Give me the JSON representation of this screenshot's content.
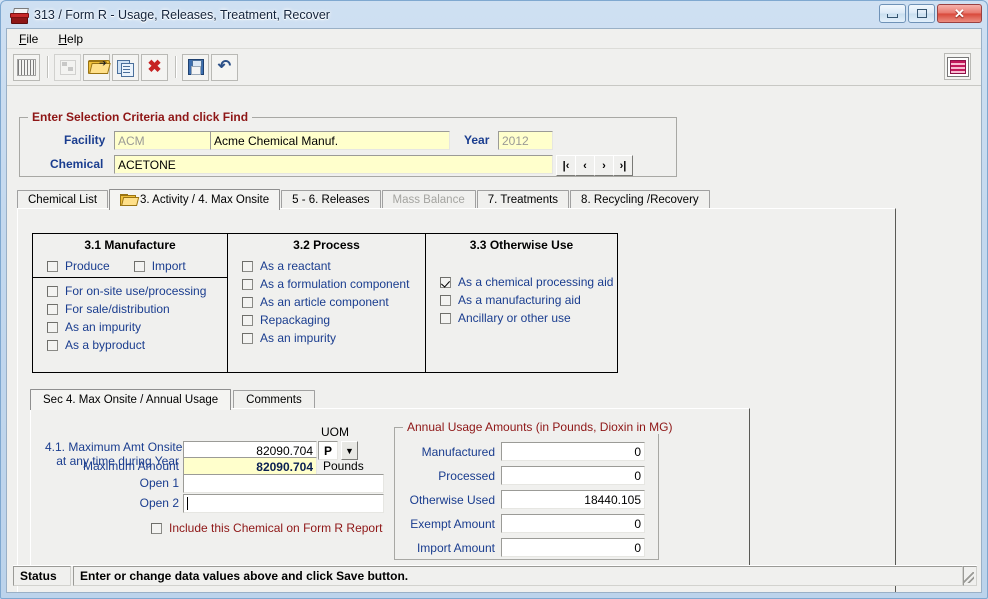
{
  "window": {
    "title": "313 / Form R - Usage, Releases, Treatment, Recover",
    "app_icon": "form-stamp-icon",
    "minimize_label": "",
    "maximize_label": "",
    "close_label": "✕"
  },
  "menu": {
    "items": [
      {
        "label": "File",
        "accel": "F",
        "rest": "ile"
      },
      {
        "label": "Help",
        "accel": "H",
        "rest": "elp"
      }
    ]
  },
  "toolbar": {
    "buttons": [
      {
        "name": "barcode-button",
        "icon": "barcode-icon",
        "enabled": true
      },
      {
        "name": "find-button",
        "icon": "find-records-icon",
        "enabled": false
      },
      {
        "name": "open-button",
        "icon": "open-folder-icon",
        "enabled": true
      },
      {
        "name": "copy-button",
        "icon": "copy-icon",
        "enabled": true
      },
      {
        "name": "delete-button",
        "icon": "delete-x-icon",
        "enabled": true
      },
      {
        "name": "save-button",
        "icon": "save-disk-icon",
        "enabled": true
      },
      {
        "name": "undo-button",
        "icon": "undo-arrow-icon",
        "enabled": true
      }
    ],
    "right_button": {
      "name": "report-grid-button",
      "icon": "grid-table-icon"
    }
  },
  "selection_criteria": {
    "title": "Enter Selection Criteria and click Find",
    "facility_label": "Facility",
    "facility_code": "ACM",
    "facility_name": "Acme Chemical Manuf.",
    "year_label": "Year",
    "year_value": "2012",
    "chemical_label": "Chemical",
    "chemical_value": "ACETONE",
    "nav": {
      "first": "|‹",
      "prev": "‹",
      "next": "›",
      "last": "›|"
    }
  },
  "tabs": [
    {
      "label": "Chemical List",
      "active": false,
      "disabled": false,
      "icon": ""
    },
    {
      "label": "3. Activity / 4. Max Onsite",
      "active": true,
      "disabled": false,
      "icon": "open-folder-icon"
    },
    {
      "label": "5 - 6. Releases",
      "active": false,
      "disabled": false,
      "icon": ""
    },
    {
      "label": "Mass Balance",
      "active": false,
      "disabled": true,
      "icon": ""
    },
    {
      "label": "7. Treatments",
      "active": false,
      "disabled": false,
      "icon": ""
    },
    {
      "label": "8. Recycling /Recovery",
      "active": false,
      "disabled": false,
      "icon": ""
    }
  ],
  "activity": {
    "manufacture": {
      "title": "3.1 Manufacture",
      "top_row": [
        {
          "label": "Produce",
          "checked": false
        },
        {
          "label": "Import",
          "checked": false
        }
      ],
      "items": [
        {
          "label": "For on-site use/processing",
          "checked": false
        },
        {
          "label": "For sale/distribution",
          "checked": false
        },
        {
          "label": "As an impurity",
          "checked": false
        },
        {
          "label": "As a byproduct",
          "checked": false
        }
      ]
    },
    "process": {
      "title": "3.2 Process",
      "items": [
        {
          "label": "As a reactant",
          "checked": false
        },
        {
          "label": "As a formulation component",
          "checked": false
        },
        {
          "label": "As an article component",
          "checked": false
        },
        {
          "label": "Repackaging",
          "checked": false
        },
        {
          "label": "As an impurity",
          "checked": false
        }
      ]
    },
    "otherwise_use": {
      "title": "3.3 Otherwise Use",
      "items": [
        {
          "label": "As a chemical processing aid",
          "checked": true
        },
        {
          "label": "As a manufacturing aid",
          "checked": false
        },
        {
          "label": "Ancillary or other use",
          "checked": false
        }
      ]
    }
  },
  "subtabs": [
    {
      "label": "Sec 4. Max Onsite / Annual Usage",
      "active": true
    },
    {
      "label": "Comments",
      "active": false
    }
  ],
  "sec4": {
    "max_onsite_label_line1": "4.1. Maximum Amt Onsite",
    "max_onsite_label_line2": "at any time during Year",
    "max_onsite_value": "82090.704",
    "uom_label": "UOM",
    "uom_value": "P",
    "maximum_amount_label": "Maximum Amount",
    "maximum_amount_value": "82090.704",
    "maximum_amount_units": "Pounds",
    "open1_label": "Open 1",
    "open1_value": "",
    "open2_label": "Open 2",
    "open2_value": "",
    "include_checkbox_label": "Include this Chemical on Form R Report",
    "include_checked": false
  },
  "annual_usage": {
    "title": "Annual Usage Amounts (in Pounds, Dioxin in MG)",
    "rows": [
      {
        "label": "Manufactured",
        "value": "0"
      },
      {
        "label": "Processed",
        "value": "0"
      },
      {
        "label": "Otherwise Used",
        "value": "18440.105"
      },
      {
        "label": "Exempt Amount",
        "value": "0"
      },
      {
        "label": "Import Amount",
        "value": "0"
      }
    ]
  },
  "statusbar": {
    "label": "Status",
    "message": "Enter or change data values above and click Save button."
  },
  "colors": {
    "label_blue": "#1a3d8f",
    "group_title_red": "#8e1616",
    "field_yellow": "#ffffcc",
    "window_blue": "#c3d8ee"
  }
}
